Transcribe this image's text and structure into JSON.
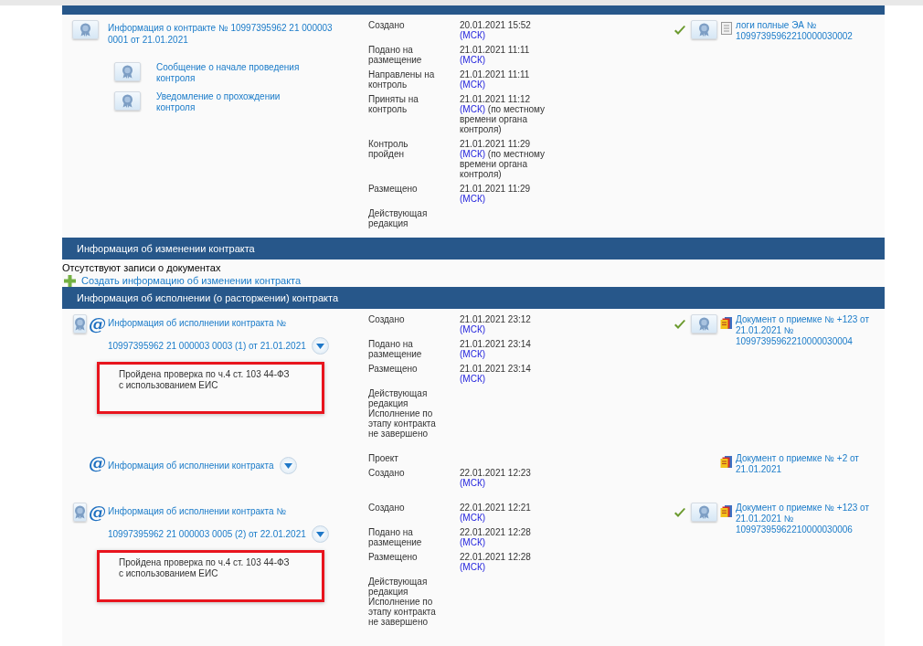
{
  "sections": [
    {
      "entries": [
        {
          "seal": true,
          "link": [
            "Информация о контракте № 10997395962 21 000003",
            "0001 от 21.01.2021"
          ],
          "dropdown": false,
          "subdocs": [
            {
              "seal": true,
              "link": "Сообщение о начале проведения контроля"
            },
            {
              "seal": true,
              "link": "Уведомление о прохождении контроля"
            }
          ],
          "events": [
            {
              "label": "Создано",
              "date": "20.01.2021 15:52",
              "tz": "(МСК)"
            },
            {
              "label": "Подано на размещение",
              "date": "21.01.2021 11:11",
              "tz": "(МСК)"
            },
            {
              "label": "Направлены на контроль",
              "date": "21.01.2021 11:11",
              "tz": "(МСК)"
            },
            {
              "label": "Приняты на контроль",
              "date": "21.01.2021 11:12",
              "tz": "(МСК)",
              "note": "(по местному времени органа контроля)"
            },
            {
              "label": "Контроль пройден",
              "date": "21.01.2021 11:29",
              "tz": "(МСК)",
              "note": "(по местному времени органа контроля)"
            },
            {
              "label": "Размещено",
              "date": "21.01.2021 11:29",
              "tz": "(МСК)"
            },
            {
              "label": "Действующая редакция"
            }
          ],
          "docs": [
            {
              "signed": true,
              "seal": true,
              "kind": "log",
              "link": "логи полные ЭА № 10997395962210000030002"
            }
          ]
        }
      ]
    },
    {
      "title": "Информация об изменении контракта",
      "empty_text": "Отсутствуют записи о документах",
      "create_link": "Создать информацию об изменении контракта"
    },
    {
      "title": "Информация об исполнении (о расторжении) контракта",
      "entries": [
        {
          "seal": true,
          "at_sign": "@",
          "link": [
            "Информация об исполнении контракта №",
            "10997395962 21 000003 0003 (1) от 21.01.2021"
          ],
          "dropdown": true,
          "note": {
            "lines": [
              "Пройдена проверка по ч.4 ст. 103 44-ФЗ",
              "с использованием ЕИС"
            ],
            "highlighted": true
          },
          "events": [
            {
              "label": "Создано",
              "date": "21.01.2021 23:12",
              "tz": "(МСК)"
            },
            {
              "label": "Подано на размещение",
              "date": "21.01.2021 23:14",
              "tz": "(МСК)"
            },
            {
              "label": "Размещено",
              "date": "21.01.2021 23:14",
              "tz": "(МСК)"
            },
            {
              "label": "Действующая редакция"
            }
          ],
          "status": "Исполнение по этапу контракта не завершено",
          "docs": [
            {
              "signed": true,
              "seal": true,
              "kind": "acceptance",
              "link": "Документ о приемке № +123 от 21.01.2021 № 10997395962210000030004"
            }
          ]
        },
        {
          "seal": false,
          "at_sign": "@",
          "link": [
            "Информация об исполнении контракта"
          ],
          "dropdown": true,
          "events": [
            {
              "label": "Проект"
            },
            {
              "label": "Создано",
              "date": "22.01.2021 12:23",
              "tz": "(МСК)"
            }
          ],
          "docs": [
            {
              "signed": false,
              "seal": false,
              "kind": "acceptance",
              "link": "Документ о приемке № +2 от 21.01.2021"
            }
          ]
        },
        {
          "seal": true,
          "at_sign": "@",
          "link": [
            "Информация об исполнении контракта №",
            "10997395962 21 000003 0005 (2) от 22.01.2021"
          ],
          "dropdown": true,
          "note": {
            "lines": [
              "Пройдена проверка по ч.4 ст. 103 44-ФЗ",
              "с использованием ЕИС"
            ],
            "highlighted": true
          },
          "events": [
            {
              "label": "Создано",
              "date": "22.01.2021 12:21",
              "tz": "(МСК)"
            },
            {
              "label": "Подано на размещение",
              "date": "22.01.2021 12:28",
              "tz": "(МСК)"
            },
            {
              "label": "Размещено",
              "date": "22.01.2021 12:28",
              "tz": "(МСК)"
            },
            {
              "label": "Действующая редакция"
            }
          ],
          "status": "Исполнение по этапу контракта не завершено",
          "docs": [
            {
              "signed": true,
              "seal": true,
              "kind": "acceptance",
              "link": "Документ о приемке № +123 от 21.01.2021 № 10997395962210000030006"
            }
          ]
        }
      ]
    }
  ]
}
